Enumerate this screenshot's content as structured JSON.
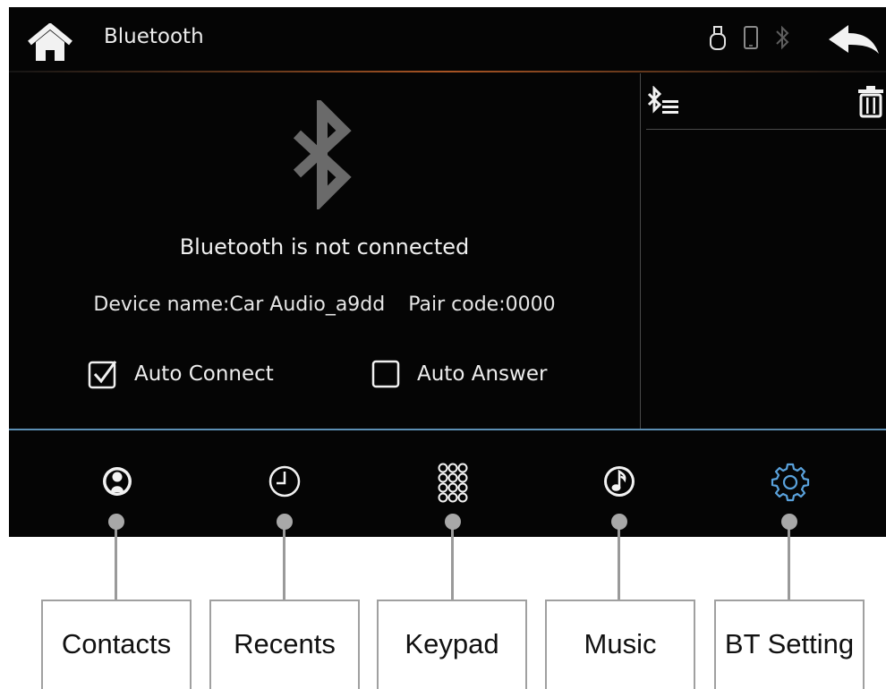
{
  "header": {
    "title": "Bluetooth"
  },
  "main": {
    "status_text": "Bluetooth is not connected",
    "device_name": "Device name:Car Audio_a9dd",
    "pair_code": "Pair code:0000",
    "auto_connect": {
      "label": "Auto Connect",
      "checked": true
    },
    "auto_answer": {
      "label": "Auto Answer",
      "checked": false
    }
  },
  "colors": {
    "background": "#050505",
    "accent_blue": "#5aa2dc",
    "divider_blue": "#5c8fb4",
    "header_line": "#a85424",
    "bt_logo_gray": "#6a6a6a"
  },
  "icons": {
    "header": [
      "home-icon",
      "usb-icon",
      "phone-icon",
      "bluetooth-status-icon",
      "back-arrow-icon"
    ],
    "side": [
      "bluetooth-list-icon",
      "trash-icon"
    ],
    "nav": [
      "contacts-icon",
      "recents-icon",
      "keypad-icon",
      "music-icon",
      "settings-icon"
    ]
  },
  "nav": {
    "active": "bt_setting",
    "labels": {
      "contacts": "Contacts",
      "recents": "Recents",
      "keypad": "Keypad",
      "music": "Music",
      "bt_setting": "BT Setting"
    }
  }
}
